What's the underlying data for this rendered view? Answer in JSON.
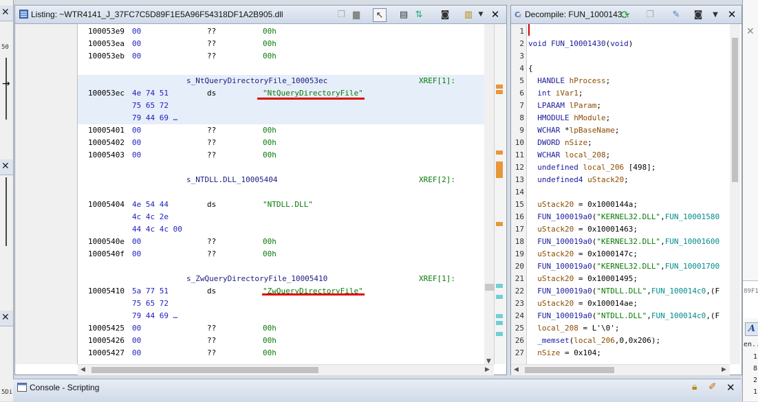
{
  "listing": {
    "title": "Listing:  ~WTR4141_J_37FC7C5D89F1E5A96F54318DF1A2B905.dll",
    "rows": [
      {
        "type": "data",
        "addr": "100053e9",
        "bytes": "00",
        "mnem": "??",
        "opnd": "00h"
      },
      {
        "type": "data",
        "addr": "100053ea",
        "bytes": "00",
        "mnem": "??",
        "opnd": "00h"
      },
      {
        "type": "data",
        "addr": "100053eb",
        "bytes": "00",
        "mnem": "??",
        "opnd": "00h"
      },
      {
        "type": "blank"
      },
      {
        "type": "label",
        "text": "s_NtQueryDirectoryFile_100053ec",
        "xref": "XREF[1]:",
        "hl": true
      },
      {
        "type": "data",
        "addr": "100053ec",
        "bytes": "4e 74 51",
        "mnem": "ds",
        "opnd": "\"NtQueryDirectoryFile\"",
        "hl": true
      },
      {
        "type": "data",
        "addr": "",
        "bytes": "75 65 72",
        "mnem": "",
        "opnd": "",
        "hl": true
      },
      {
        "type": "data",
        "addr": "",
        "bytes": "79 44 69 …",
        "mnem": "",
        "opnd": "",
        "hl": true
      },
      {
        "type": "data",
        "addr": "10005401",
        "bytes": "00",
        "mnem": "??",
        "opnd": "00h"
      },
      {
        "type": "data",
        "addr": "10005402",
        "bytes": "00",
        "mnem": "??",
        "opnd": "00h"
      },
      {
        "type": "data",
        "addr": "10005403",
        "bytes": "00",
        "mnem": "??",
        "opnd": "00h"
      },
      {
        "type": "blank"
      },
      {
        "type": "label",
        "text": "s_NTDLL.DLL_10005404",
        "xref": "XREF[2]:"
      },
      {
        "type": "blank"
      },
      {
        "type": "data",
        "addr": "10005404",
        "bytes": "4e 54 44",
        "mnem": "ds",
        "opnd": "\"NTDLL.DLL\""
      },
      {
        "type": "data",
        "addr": "",
        "bytes": "4c 4c 2e",
        "mnem": "",
        "opnd": ""
      },
      {
        "type": "data",
        "addr": "",
        "bytes": "44 4c 4c 00",
        "mnem": "",
        "opnd": ""
      },
      {
        "type": "data",
        "addr": "1000540e",
        "bytes": "00",
        "mnem": "??",
        "opnd": "00h"
      },
      {
        "type": "data",
        "addr": "1000540f",
        "bytes": "00",
        "mnem": "??",
        "opnd": "00h"
      },
      {
        "type": "blank"
      },
      {
        "type": "label",
        "text": "s_ZwQueryDirectoryFile_10005410",
        "xref": "XREF[1]:"
      },
      {
        "type": "data",
        "addr": "10005410",
        "bytes": "5a 77 51",
        "mnem": "ds",
        "opnd": "\"ZwQueryDirectoryFile\""
      },
      {
        "type": "data",
        "addr": "",
        "bytes": "75 65 72",
        "mnem": "",
        "opnd": ""
      },
      {
        "type": "data",
        "addr": "",
        "bytes": "79 44 69 …",
        "mnem": "",
        "opnd": ""
      },
      {
        "type": "data",
        "addr": "10005425",
        "bytes": "00",
        "mnem": "??",
        "opnd": "00h"
      },
      {
        "type": "data",
        "addr": "10005426",
        "bytes": "00",
        "mnem": "??",
        "opnd": "00h"
      },
      {
        "type": "data",
        "addr": "10005427",
        "bytes": "00",
        "mnem": "??",
        "opnd": "00h"
      }
    ]
  },
  "decompile": {
    "title": "Decompile: FUN_1000143...",
    "lines": [
      [],
      [
        {
          "t": "void ",
          "c": "kw"
        },
        {
          "t": "FUN_10001430",
          "c": "fn"
        },
        {
          "t": "(",
          "c": ""
        },
        {
          "t": "void",
          "c": "kw"
        },
        {
          "t": ")",
          "c": ""
        }
      ],
      [],
      [
        {
          "t": "{",
          "c": ""
        }
      ],
      [
        {
          "t": "  HANDLE ",
          "c": "kw"
        },
        {
          "t": "hProcess",
          "c": "var"
        },
        {
          "t": ";",
          "c": ""
        }
      ],
      [
        {
          "t": "  int ",
          "c": "kw"
        },
        {
          "t": "iVar1",
          "c": "var"
        },
        {
          "t": ";",
          "c": ""
        }
      ],
      [
        {
          "t": "  LPARAM ",
          "c": "kw"
        },
        {
          "t": "lParam",
          "c": "var"
        },
        {
          "t": ";",
          "c": ""
        }
      ],
      [
        {
          "t": "  HMODULE ",
          "c": "kw"
        },
        {
          "t": "hModule",
          "c": "var"
        },
        {
          "t": ";",
          "c": ""
        }
      ],
      [
        {
          "t": "  WCHAR ",
          "c": "kw"
        },
        {
          "t": "*",
          "c": ""
        },
        {
          "t": "lpBaseName",
          "c": "var"
        },
        {
          "t": ";",
          "c": ""
        }
      ],
      [
        {
          "t": "  DWORD ",
          "c": "kw"
        },
        {
          "t": "nSize",
          "c": "var"
        },
        {
          "t": ";",
          "c": ""
        }
      ],
      [
        {
          "t": "  WCHAR ",
          "c": "kw"
        },
        {
          "t": "local_208",
          "c": "var"
        },
        {
          "t": ";",
          "c": ""
        }
      ],
      [
        {
          "t": "  undefined ",
          "c": "kw"
        },
        {
          "t": "local_206",
          "c": "var"
        },
        {
          "t": " [498];",
          "c": ""
        }
      ],
      [
        {
          "t": "  undefined4 ",
          "c": "kw"
        },
        {
          "t": "uStack20",
          "c": "var"
        },
        {
          "t": ";",
          "c": ""
        }
      ],
      [],
      [
        {
          "t": "  uStack20",
          "c": "var"
        },
        {
          "t": " = 0x1000144a;",
          "c": ""
        }
      ],
      [
        {
          "t": "  FUN_100019a0",
          "c": "fn"
        },
        {
          "t": "(",
          "c": ""
        },
        {
          "t": "\"KERNEL32.DLL\"",
          "c": "str"
        },
        {
          "t": ",",
          "c": ""
        },
        {
          "t": "FUN_10001580",
          "c": "tealc"
        }
      ],
      [
        {
          "t": "  uStack20",
          "c": "var"
        },
        {
          "t": " = 0x10001463;",
          "c": ""
        }
      ],
      [
        {
          "t": "  FUN_100019a0",
          "c": "fn"
        },
        {
          "t": "(",
          "c": ""
        },
        {
          "t": "\"KERNEL32.DLL\"",
          "c": "str"
        },
        {
          "t": ",",
          "c": ""
        },
        {
          "t": "FUN_10001600",
          "c": "tealc"
        }
      ],
      [
        {
          "t": "  uStack20",
          "c": "var"
        },
        {
          "t": " = 0x1000147c;",
          "c": ""
        }
      ],
      [
        {
          "t": "  FUN_100019a0",
          "c": "fn"
        },
        {
          "t": "(",
          "c": ""
        },
        {
          "t": "\"KERNEL32.DLL\"",
          "c": "str"
        },
        {
          "t": ",",
          "c": ""
        },
        {
          "t": "FUN_10001700",
          "c": "tealc"
        }
      ],
      [
        {
          "t": "  uStack20",
          "c": "var"
        },
        {
          "t": " = 0x10001495;",
          "c": ""
        }
      ],
      [
        {
          "t": "  FUN_100019a0",
          "c": "fn"
        },
        {
          "t": "(",
          "c": ""
        },
        {
          "t": "\"NTDLL.DLL\"",
          "c": "str"
        },
        {
          "t": ",",
          "c": ""
        },
        {
          "t": "FUN_100014c0",
          "c": "tealc"
        },
        {
          "t": ",(F",
          "c": ""
        }
      ],
      [
        {
          "t": "  uStack20",
          "c": "var"
        },
        {
          "t": " = 0x100014ae;",
          "c": ""
        }
      ],
      [
        {
          "t": "  FUN_100019a0",
          "c": "fn"
        },
        {
          "t": "(",
          "c": ""
        },
        {
          "t": "\"NTDLL.DLL\"",
          "c": "str"
        },
        {
          "t": ",",
          "c": ""
        },
        {
          "t": "FUN_100014c0",
          "c": "tealc"
        },
        {
          "t": ",(F",
          "c": ""
        }
      ],
      [
        {
          "t": "  local_208",
          "c": "var"
        },
        {
          "t": " = L'\\0';",
          "c": ""
        }
      ],
      [
        {
          "t": "  _memset",
          "c": "fn"
        },
        {
          "t": "(",
          "c": ""
        },
        {
          "t": "local_206",
          "c": "var"
        },
        {
          "t": ",0,0x206);",
          "c": ""
        }
      ],
      [
        {
          "t": "  nSize",
          "c": "var"
        },
        {
          "t": " = 0x104;",
          "c": ""
        }
      ]
    ]
  },
  "console": {
    "title": "Console - Scripting"
  },
  "left_strip": {
    "fragments": [
      "50",
      "5Di"
    ]
  },
  "right_strip": {
    "fragments": [
      "89F1E",
      "A",
      "en...",
      "1",
      "8",
      "2",
      "1"
    ]
  },
  "colors": {
    "highlight": "#e6eef9",
    "underline": "#e00000",
    "address_bytes": "#2020c0",
    "operand": "#067a06",
    "label": "#1c1c80"
  }
}
